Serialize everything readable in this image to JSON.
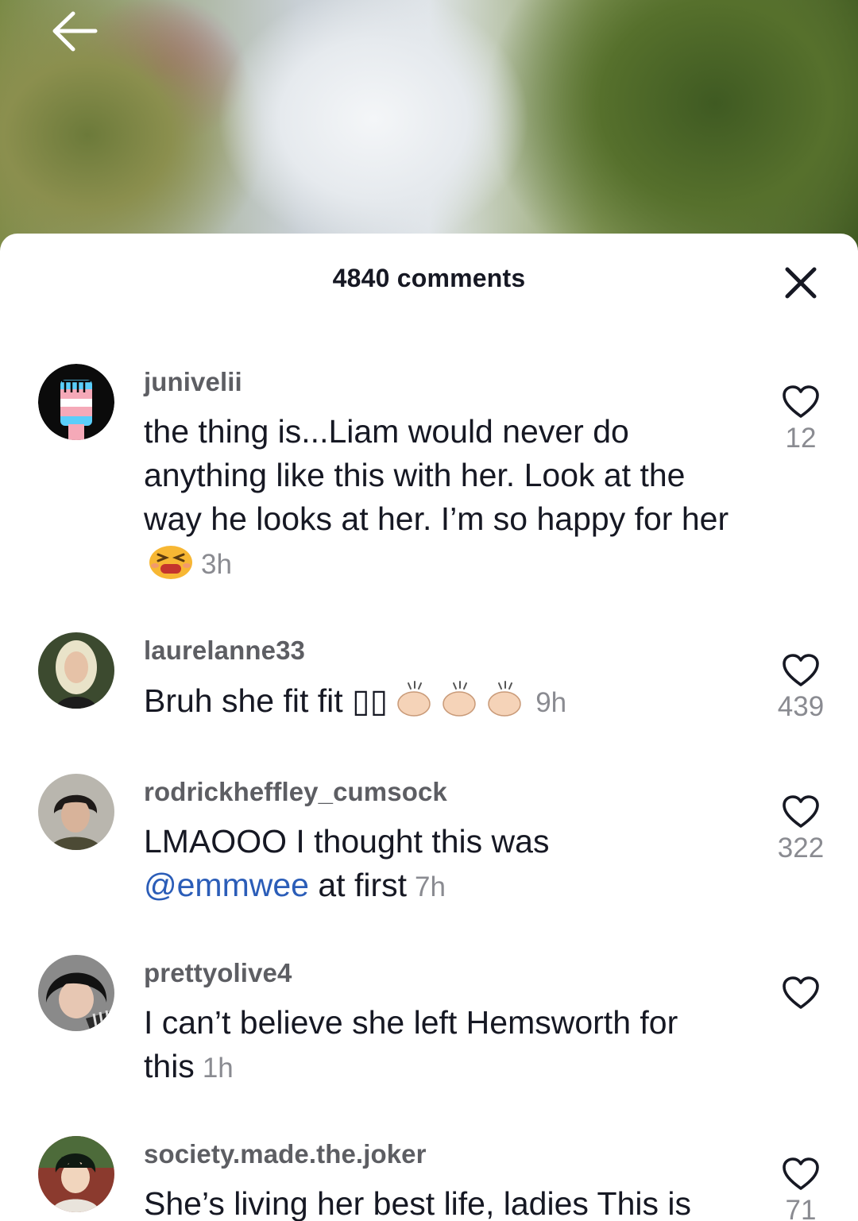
{
  "header": {
    "comment_count": "4840 comments"
  },
  "icons": {
    "back": "arrow-left-icon",
    "close": "close-icon",
    "like": "heart-outline-icon"
  },
  "colors": {
    "mention": "#2b5db8",
    "username": "#5d5e63",
    "muted": "#8a8b91"
  },
  "comments": [
    {
      "username": "junivelii",
      "text": "the thing is...Liam would never do anything like this with her. Look at the way he looks at her. I’m so happy for her",
      "emoji": "tired-face-emoji",
      "time": "3h",
      "likes": "12"
    },
    {
      "username": "laurelanne33",
      "text": "Bruh she fit fit ▯▯",
      "emoji": "clapping-hands-emoji x3",
      "time": "9h",
      "likes": "439"
    },
    {
      "username": "rodrickheffley_cumsock",
      "text_before": "LMAOOO I thought this was",
      "mention": "@emmwee",
      "text_after": "at first",
      "time": "7h",
      "likes": "322"
    },
    {
      "username": "prettyolive4",
      "text": "I can’t believe she left Hemsworth for this",
      "time": "1h",
      "likes": ""
    },
    {
      "username": "society.made.the.joker",
      "text": "She’s living her best life, ladies This is",
      "likes": "71"
    }
  ]
}
